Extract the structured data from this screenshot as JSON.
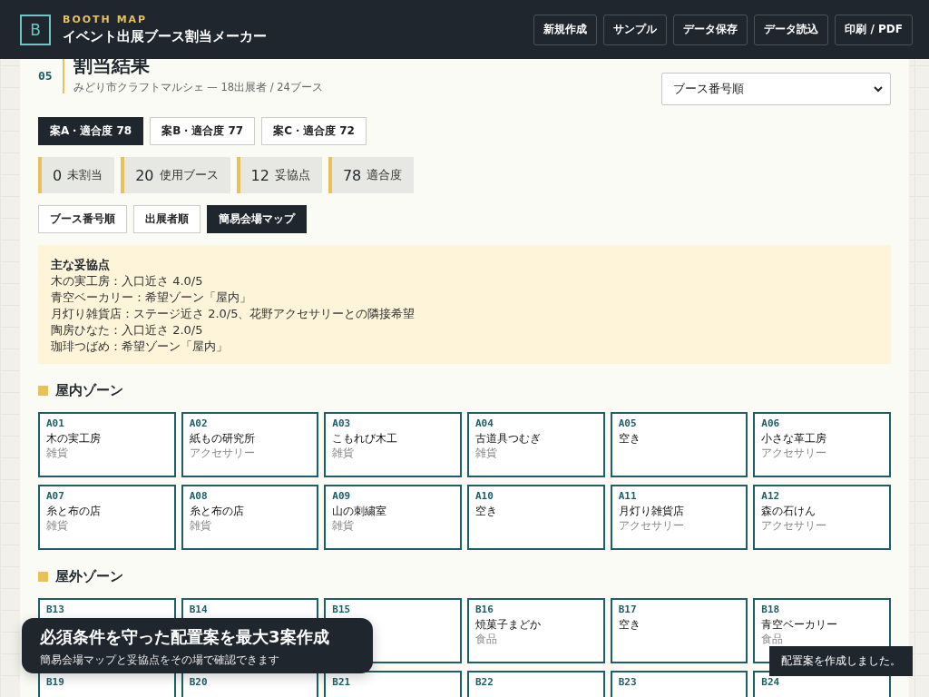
{
  "header": {
    "logo": "B",
    "eyebrow": "BOOTH MAP",
    "title": "イベント出展ブース割当メーカー",
    "buttons": [
      "新規作成",
      "サンプル",
      "データ保存",
      "データ読込",
      "印刷 / PDF"
    ]
  },
  "result": {
    "step": "05",
    "title": "割当結果",
    "subtitle": "みどり市クラフトマルシェ — 18出展者 / 24ブース",
    "sort_select": {
      "value": "ブース番号順"
    },
    "plans": [
      {
        "label": "案A・適合度 78",
        "selected": true
      },
      {
        "label": "案B・適合度 77",
        "selected": false
      },
      {
        "label": "案C・適合度 72",
        "selected": false
      }
    ],
    "stats": [
      {
        "value": "0",
        "label": "未割当"
      },
      {
        "value": "20",
        "label": "使用ブース"
      },
      {
        "value": "12",
        "label": "妥協点"
      },
      {
        "value": "78",
        "label": "適合度"
      }
    ],
    "views": [
      {
        "label": "ブース番号順",
        "selected": false
      },
      {
        "label": "出展者順",
        "selected": false
      },
      {
        "label": "簡易会場マップ",
        "selected": true
      }
    ],
    "compromises": {
      "title": "主な妥協点",
      "lines": [
        "木の実工房：入口近さ 4.0/5",
        "青空ベーカリー：希望ゾーン「屋内」",
        "月灯り雑貨店：ステージ近さ 2.0/5、花野アクセサリーとの隣接希望",
        "陶房ひなた：入口近さ 2.0/5",
        "珈琲つばめ：希望ゾーン「屋内」"
      ]
    },
    "zones": [
      {
        "name": "屋内ゾーン",
        "booths": [
          {
            "id": "A01",
            "name": "木の実工房",
            "genre": "雑貨"
          },
          {
            "id": "A02",
            "name": "紙もの研究所",
            "genre": "アクセサリー"
          },
          {
            "id": "A03",
            "name": "こもれび木工",
            "genre": "雑貨"
          },
          {
            "id": "A04",
            "name": "古道具つむぎ",
            "genre": "雑貨"
          },
          {
            "id": "A05",
            "name": "空き"
          },
          {
            "id": "A06",
            "name": "小さな革工房",
            "genre": "アクセサリー"
          },
          {
            "id": "A07",
            "name": "糸と布の店",
            "genre": "雑貨"
          },
          {
            "id": "A08",
            "name": "糸と布の店",
            "genre": "雑貨"
          },
          {
            "id": "A09",
            "name": "山の刺繍室",
            "genre": "雑貨"
          },
          {
            "id": "A10",
            "name": "空き"
          },
          {
            "id": "A11",
            "name": "月灯り雑貨店",
            "genre": "アクセサリー"
          },
          {
            "id": "A12",
            "name": "森の石けん",
            "genre": "アクセサリー"
          }
        ]
      },
      {
        "name": "屋外ゾーン",
        "booths": [
          {
            "id": "B13"
          },
          {
            "id": "B14"
          },
          {
            "id": "B15"
          },
          {
            "id": "B16",
            "name": "焼菓子まどか",
            "genre": "食品"
          },
          {
            "id": "B17",
            "name": "空き"
          },
          {
            "id": "B18",
            "name": "青空ベーカリー",
            "genre": "食品"
          },
          {
            "id": "B19"
          },
          {
            "id": "B20"
          },
          {
            "id": "B21"
          },
          {
            "id": "B22"
          },
          {
            "id": "B23"
          },
          {
            "id": "B24"
          }
        ]
      }
    ]
  },
  "banner": {
    "title": "必須条件を守った配置案を最大3案作成",
    "subtitle": "簡易会場マップと妥協点をその場で確認できます"
  },
  "toast": "配置案を作成しました。"
}
